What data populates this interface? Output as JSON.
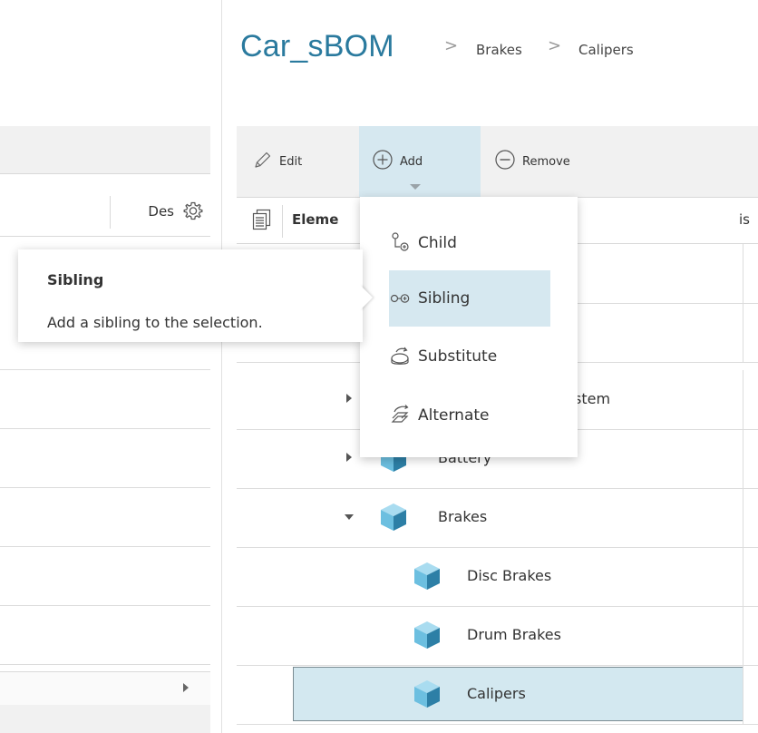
{
  "breadcrumb": {
    "root": "Car_sBOM",
    "separator": ">",
    "items": [
      "Brakes",
      "Calipers"
    ]
  },
  "left_panel": {
    "column_label": "Des",
    "icons": {
      "settings": "gear-icon",
      "expand": "triangle-right-icon"
    }
  },
  "toolbar": {
    "edit_label": "Edit",
    "add_label": "Add",
    "remove_label": "Remove",
    "icons": {
      "edit": "pencil-icon",
      "add": "plus-circle-icon",
      "remove": "minus-circle-icon"
    }
  },
  "tree": {
    "column_header": "Eleme",
    "column_header_right": "is",
    "rows": [
      {
        "label": "stem",
        "expander": "collapsed"
      },
      {
        "label": "Battery",
        "expander": "collapsed"
      },
      {
        "label": "Brakes",
        "expander": "expanded"
      },
      {
        "label": "Disc Brakes",
        "expander": "none"
      },
      {
        "label": "Drum Brakes",
        "expander": "none"
      },
      {
        "label": "Calipers",
        "expander": "none",
        "selected": true
      }
    ]
  },
  "add_menu": {
    "items": [
      {
        "label": "Child",
        "icon": "child-node-icon"
      },
      {
        "label": "Sibling",
        "icon": "sibling-node-icon",
        "hovered": true
      },
      {
        "label": "Substitute",
        "icon": "substitute-icon"
      },
      {
        "label": "Alternate",
        "icon": "alternate-icon"
      }
    ]
  },
  "tooltip": {
    "title": "Sibling",
    "body": "Add a sibling to the selection."
  },
  "colors": {
    "accent": "#2a7a9e",
    "selection": "#d3e8f0",
    "hover": "#d6e8f0",
    "toolbar_bg": "#f1f1f1",
    "cube_light": "#8fd0ea",
    "cube_dark": "#2d7fa6"
  }
}
